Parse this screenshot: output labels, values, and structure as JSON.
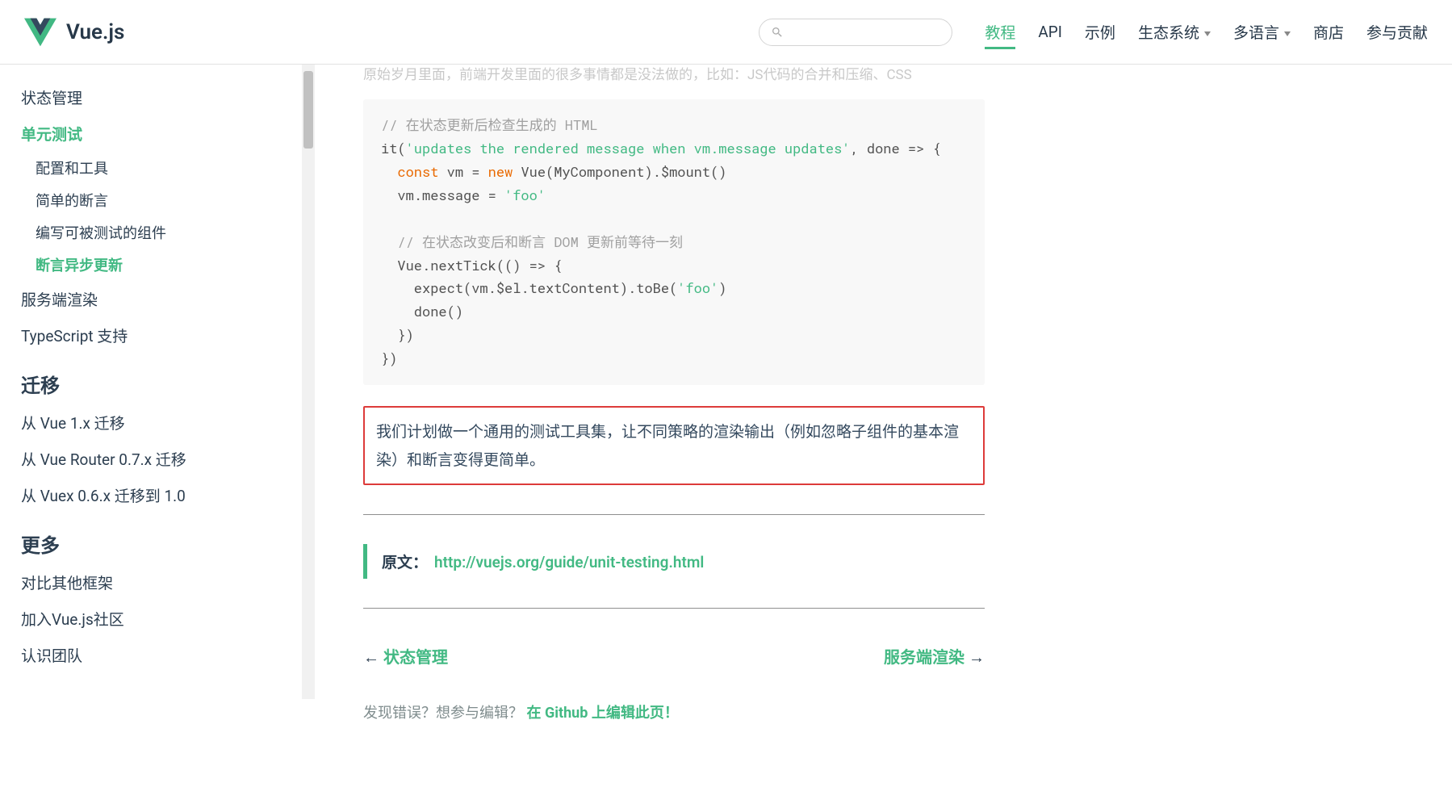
{
  "header": {
    "site_title": "Vue.js",
    "nav": [
      {
        "label": "教程",
        "active": true,
        "dropdown": false
      },
      {
        "label": "API",
        "active": false,
        "dropdown": false
      },
      {
        "label": "示例",
        "active": false,
        "dropdown": false
      },
      {
        "label": "生态系统",
        "active": false,
        "dropdown": true
      },
      {
        "label": "多语言",
        "active": false,
        "dropdown": true
      },
      {
        "label": "商店",
        "active": false,
        "dropdown": false
      },
      {
        "label": "参与贡献",
        "active": false,
        "dropdown": false
      }
    ]
  },
  "sidebar": {
    "section_tools": [
      {
        "label": "状态管理",
        "active": false
      },
      {
        "label": "单元测试",
        "active": true,
        "children": [
          {
            "label": "配置和工具",
            "active": false
          },
          {
            "label": "简单的断言",
            "active": false
          },
          {
            "label": "编写可被测试的组件",
            "active": false
          },
          {
            "label": "断言异步更新",
            "active": true
          }
        ]
      },
      {
        "label": "服务端渲染",
        "active": false
      },
      {
        "label": "TypeScript 支持",
        "active": false
      }
    ],
    "heading_migration": "迁移",
    "section_migration": [
      {
        "label": "从 Vue 1.x 迁移"
      },
      {
        "label": "从 Vue Router 0.7.x 迁移"
      },
      {
        "label": "从 Vuex 0.6.x 迁移到 1.0"
      }
    ],
    "heading_more": "更多",
    "section_more": [
      {
        "label": "对比其他框架"
      },
      {
        "label": "加入Vue.js社区"
      },
      {
        "label": "认识团队"
      }
    ]
  },
  "content": {
    "faded_top": "原始岁月里面，前端开发里面的很多事情都是没法做的，比如：JS代码的合并和压缩、CSS",
    "code": {
      "c1": "// 在状态更新后检查生成的 HTML",
      "l2a": "it(",
      "l2s": "'updates the rendered message when vm.message updates'",
      "l2b": ", done => {",
      "l3a": "  ",
      "l3kw1": "const",
      "l3b": " vm = ",
      "l3kw2": "new",
      "l3c": " Vue(MyComponent).$mount()",
      "l4a": "  vm.message = ",
      "l4s": "'foo'",
      "c2": "  // 在状态改变后和断言 DOM 更新前等待一刻",
      "l6": "  Vue.nextTick(() => {",
      "l7a": "    expect(vm.$el.textContent).toBe(",
      "l7s": "'foo'",
      "l7b": ")",
      "l8": "    done()",
      "l9": "  })",
      "l10": "})"
    },
    "highlight_text": "我们计划做一个通用的测试工具集，让不同策略的渲染输出（例如忽略子组件的基本渲染）和断言变得更简单。",
    "source_label": "原文：",
    "source_url": "http://vuejs.org/guide/unit-testing.html",
    "pager_prev": "状态管理",
    "pager_next": "服务端渲染",
    "edit_prefix": "发现错误？想参与编辑？",
    "edit_link": "在 Github 上编辑此页！"
  }
}
